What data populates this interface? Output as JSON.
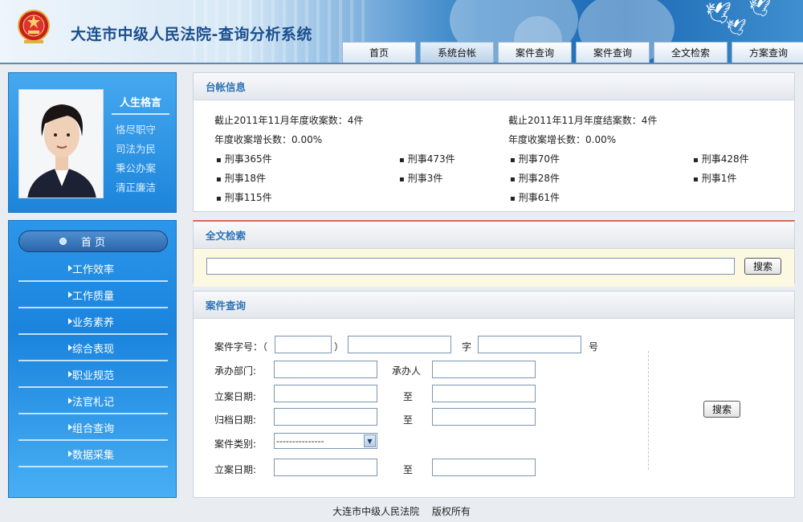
{
  "header": {
    "title": "大连市中级人民法院-查询分析系统",
    "emblem_icon": "court-emblem-icon"
  },
  "nav": {
    "tabs": [
      {
        "label": "首页",
        "active": false
      },
      {
        "label": "系统台帐",
        "active": true
      },
      {
        "label": "案件查询",
        "active": false
      },
      {
        "label": "案件查询",
        "active": false
      },
      {
        "label": "全文检索",
        "active": false
      },
      {
        "label": "方案查询",
        "active": false
      }
    ]
  },
  "profile": {
    "motto_title": "人生格言",
    "motto": [
      "恪尽职守",
      "司法为民",
      "秉公办案",
      "清正廉洁"
    ]
  },
  "menu": {
    "home": "首 页",
    "items": [
      "工作效率",
      "工作质量",
      "业务素养",
      "综合表现",
      "职业规范",
      "法官札记",
      "组合查询",
      "数据采集"
    ]
  },
  "ledger": {
    "title": "台帐信息",
    "left_summary": "截止2011年11月年度收案数：4件",
    "left_growth": "年度收案增长数：0.00%",
    "right_summary": "截止2011年11月年度结案数：4件",
    "right_growth": "年度收案增长数：0.00%",
    "col1": [
      "刑事365件",
      "刑事18件",
      "刑事115件"
    ],
    "col2": [
      "刑事473件",
      "刑事3件"
    ],
    "col3": [
      "刑事70件",
      "刑事28件",
      "刑事61件"
    ],
    "col4": [
      "刑事428件",
      "刑事1件"
    ]
  },
  "fulltext": {
    "title": "全文检索",
    "value": "",
    "search_label": "搜索"
  },
  "case_query": {
    "title": "案件查询",
    "case_no_label": "案件字号：（",
    "paren_close": "）",
    "zi": "字",
    "hao": "号",
    "dept_label": "承办部门:",
    "handler_label": "承办人",
    "filing_date_label": "立案日期:",
    "to": "至",
    "archive_date_label": "归档日期:",
    "category_label": "案件类别:",
    "category_value": "---------------",
    "filing_date2_label": "立案日期:",
    "search_label": "搜索"
  },
  "footer": {
    "org": "大连市中级人民法院",
    "rights": "版权所有"
  },
  "colors": {
    "accent": "#2d73b5",
    "menu_blue": "#1a84de"
  }
}
